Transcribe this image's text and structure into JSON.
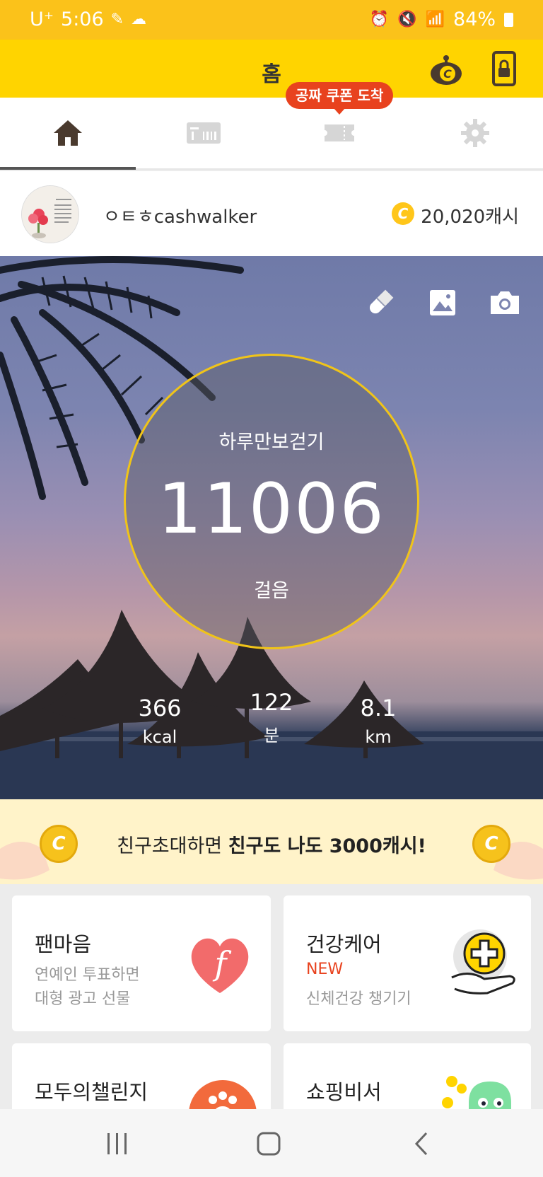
{
  "status_bar": {
    "carrier": "U⁺",
    "time": "5:06",
    "battery": "84%"
  },
  "app_bar": {
    "title": "홈"
  },
  "coupon_badge": "공짜 쿠폰 도착",
  "tabs": [
    {
      "name": "home",
      "icon": "home-icon",
      "active": true
    },
    {
      "name": "receipt",
      "icon": "receipt-icon",
      "active": false
    },
    {
      "name": "coupon",
      "icon": "ticket-icon",
      "active": false
    },
    {
      "name": "settings",
      "icon": "gear-icon",
      "active": false
    }
  ],
  "profile": {
    "username": "ㅇㅌㅎcashwalker",
    "coin_symbol": "C",
    "cash": "20,020캐시"
  },
  "hero": {
    "label": "하루만보걷기",
    "steps": "11006",
    "steps_unit": "걸음",
    "stats": [
      {
        "value": "366",
        "unit": "kcal"
      },
      {
        "value": "122",
        "unit": "분"
      },
      {
        "value": "8.1",
        "unit": "km"
      }
    ]
  },
  "banner": {
    "text_normal": "친구초대하면 ",
    "text_bold": "친구도 나도 3000캐시!",
    "coin_symbol": "C"
  },
  "cards": [
    {
      "title": "팬마음",
      "line1": "연예인 투표하면",
      "line2": "대형 광고 선물",
      "icon": "fanmaum-heart-icon"
    },
    {
      "title": "건강케어",
      "badge": "NEW",
      "line1": "신체건강 챙기기",
      "icon": "health-plus-icon"
    },
    {
      "title": "모두의챌린지",
      "icon": "paw-icon"
    },
    {
      "title": "쇼핑비서",
      "icon": "shopping-mascot-icon"
    }
  ],
  "colors": {
    "status_bar": "#fbc21a",
    "app_bar": "#ffd400",
    "badge_red": "#e8421e",
    "ring": "#f0c419"
  }
}
